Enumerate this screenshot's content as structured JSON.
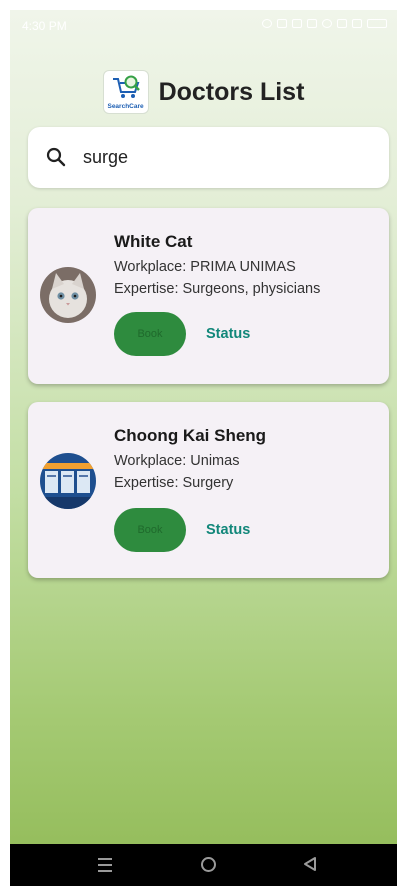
{
  "status_bar": {
    "time": "4:30 PM"
  },
  "header": {
    "logo_text": "SearchCare",
    "title": "Doctors List"
  },
  "search": {
    "value": "surge",
    "icon": "search-icon"
  },
  "doctors": [
    {
      "name": "White Cat",
      "workplace": "Workplace: PRIMA UNIMAS",
      "expertise": "Expertise: Surgeons, physicians",
      "book_label": "Book",
      "status_label": "Status"
    },
    {
      "name": "Choong Kai Sheng",
      "workplace": "Workplace: Unimas",
      "expertise": "Expertise: Surgery",
      "book_label": "Book",
      "status_label": "Status"
    }
  ],
  "colors": {
    "accent_green": "#2e8b3e",
    "status_teal": "#12877a",
    "card_background": "#f5f1f6"
  }
}
